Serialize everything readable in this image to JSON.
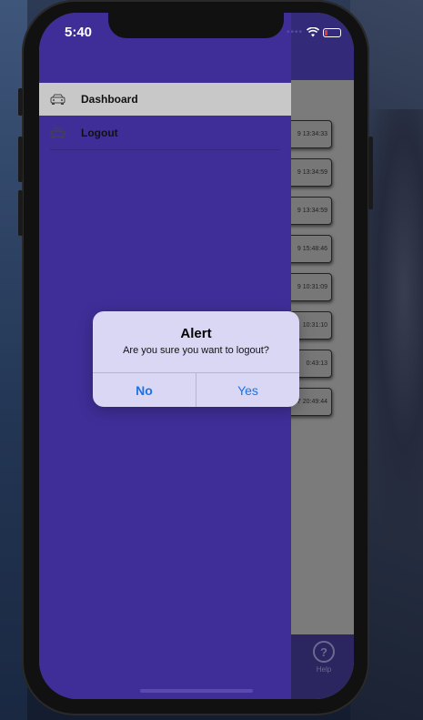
{
  "status_bar": {
    "time": "5:40"
  },
  "drawer": {
    "items": [
      {
        "label": "Dashboard",
        "icon": "car-icon",
        "active": true
      },
      {
        "label": "Logout",
        "icon": "car-icon",
        "active": false
      }
    ]
  },
  "background_list": {
    "timestamps": [
      "9 13:34:33",
      "9 13:34:59",
      "9 13:34:59",
      "9 15:48:46",
      "9 10:31:09",
      "10:31:10",
      "0:43:13",
      "7 20:49:44"
    ]
  },
  "bottom_tab": {
    "help_label": "Help",
    "help_icon": "help-icon"
  },
  "alert": {
    "title": "Alert",
    "message": "Are you sure you want to logout?",
    "no_label": "No",
    "yes_label": "Yes"
  },
  "colors": {
    "drawer": "#3f2e97",
    "active_item": "#c8c8c8",
    "alert_bg": "#d9d7f3",
    "button_text": "#1a73e8"
  }
}
